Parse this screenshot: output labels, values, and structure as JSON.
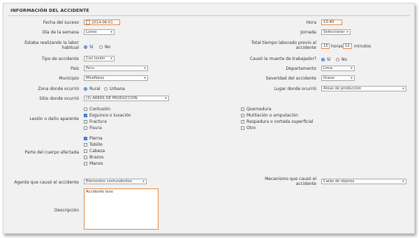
{
  "section": {
    "title": "INFORMACIÓN DEL ACCIDENTE"
  },
  "left": {
    "fecha": {
      "label": "Fecha del suceso",
      "value": "2014-06-01"
    },
    "dia": {
      "label": "Día de la semana",
      "value": "Lunes"
    },
    "labor": {
      "label_line1": "Estaba realizando la labor",
      "label_line2": "habitual",
      "opt_si": "Sí",
      "opt_no": "No",
      "selected": "Sí"
    },
    "tipo": {
      "label": "Tipo de accidente",
      "value": "Con lesión"
    },
    "pais": {
      "label": "País",
      "value": "Peru"
    },
    "municipio": {
      "label": "Municipio",
      "value": "Miraflores"
    },
    "zona": {
      "label": "Zona donde ocurrió",
      "opt_rural": "Rural",
      "opt_urbana": "Urbana",
      "selected": "Rural"
    },
    "sitio": {
      "label": "Sitio donde ocurrió",
      "value": "(2) ÁREAS DE PRODUCCIÓN"
    }
  },
  "right": {
    "hora": {
      "label": "Hora",
      "value": "13:40"
    },
    "jornada": {
      "label": "Jornada",
      "value": "Seleccionar"
    },
    "tiempo": {
      "label_line1": "Total tiempo laborado previo al",
      "label_line2": "accidente",
      "hours": "15",
      "hours_unit": "horas",
      "minutes": "12",
      "minutes_unit": "minutos"
    },
    "muerte": {
      "label": "Causó la muerte de trabajador?",
      "opt_si": "Sí",
      "opt_no": "No",
      "selected": "Sí"
    },
    "departamento": {
      "label": "Departamento",
      "value": "Lima"
    },
    "severidad": {
      "label": "Severidad del accidente",
      "value": "Grave"
    },
    "lugar": {
      "label": "Lugar donde ocurrió",
      "value": "Áreas de producción"
    }
  },
  "lesion": {
    "label": "Lesión o daño aparente",
    "col1": [
      {
        "text": "Contusión",
        "checked": false
      },
      {
        "text": "Esguince o luxación",
        "checked": true
      },
      {
        "text": "Fractura",
        "checked": false
      },
      {
        "text": "Fisura",
        "checked": false
      }
    ],
    "col2": [
      {
        "text": "Quemadura",
        "checked": false
      },
      {
        "text": "Mutilación o amputación",
        "checked": false
      },
      {
        "text": "Raspadura o cortada superficial",
        "checked": false
      },
      {
        "text": "Otro",
        "checked": false
      }
    ]
  },
  "cuerpo": {
    "label": "Parte del cuerpo afectada",
    "items": [
      {
        "text": "Pierna",
        "checked": true
      },
      {
        "text": "Tobillo",
        "checked": false
      },
      {
        "text": "Cabeza",
        "checked": false
      },
      {
        "text": "Brazos",
        "checked": false
      },
      {
        "text": "Manos",
        "checked": false
      }
    ]
  },
  "agente": {
    "label": "Agente que causó el accidente",
    "value": "Elementos contundentes"
  },
  "mecanismo": {
    "label_line1": "Mecanismo que causó el",
    "label_line2": "accidente",
    "value": "Caída de objetos"
  },
  "descripcion": {
    "label": "Descripción",
    "value": "Accidente leve"
  },
  "icons": {
    "select_arrow": "▾",
    "check_mark": "✓",
    "calendar": "calendar-icon"
  }
}
